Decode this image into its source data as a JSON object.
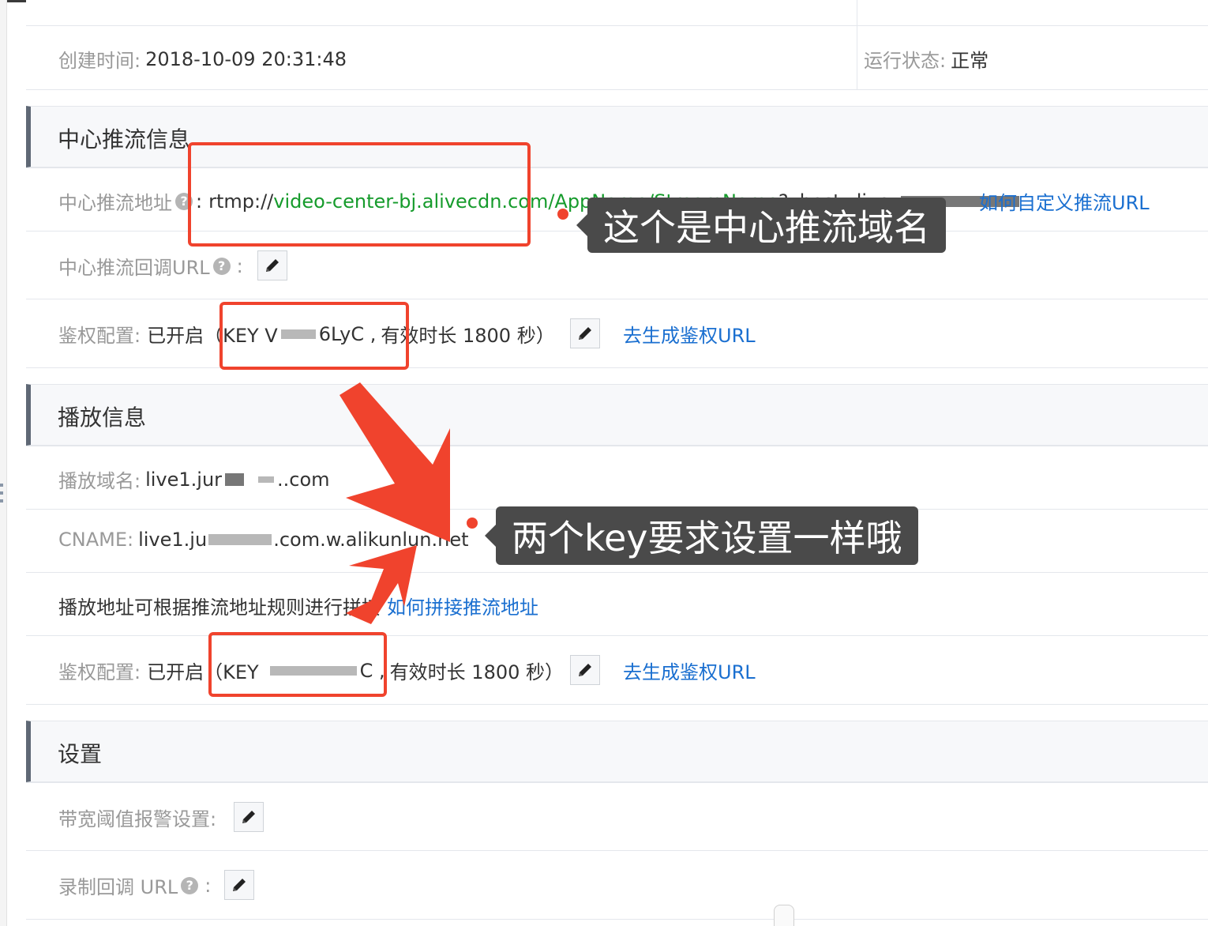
{
  "basic": {
    "created_label": "创建时间:",
    "created_value": "2018-10-09 20:31:48",
    "status_label": "运行状态:",
    "status_value": "正常"
  },
  "center_push": {
    "title": "中心推流信息",
    "address_label": "中心推流地址",
    "address_sep": ":",
    "address_prefix": "rtmp://",
    "address_domain": "video-center-bj.alivecdn.com/",
    "address_app": "AppName",
    "address_slash": "/",
    "address_stream": "StreamName",
    "address_query": "?vhost=live",
    "custom_link": "如何自定义推流URL",
    "callback_label": "中心推流回调URL",
    "callback_sep": ":",
    "auth_label": "鉴权配置:",
    "auth_status": "已开启",
    "auth_key_open": "（KEY V",
    "auth_key_tail": "6LyC ,",
    "auth_validity": "有效时长 1800 秒）",
    "auth_link": "去生成鉴权URL"
  },
  "play": {
    "title": "播放信息",
    "domain_label": "播放域名:",
    "domain_head": "live1.jur",
    "domain_tail": "..com",
    "cname_label": "CNAME:",
    "cname_head": "live1.ju",
    "cname_tail": ".com.w.alikunlun.net",
    "rule_text": "播放地址可根据推流地址规则进行拼接",
    "rule_link": "如何拼接推流地址",
    "auth_label": "鉴权配置:",
    "auth_status": "已开启",
    "auth_key_open": "（KEY",
    "auth_key_tail": "C ,",
    "auth_validity": "有效时长 1800 秒）",
    "auth_link": "去生成鉴权URL"
  },
  "settings": {
    "title": "设置",
    "bandwidth_label": "带宽阈值报警设置:",
    "record_label": "录制回调 URL",
    "record_sep": ":"
  },
  "annotations": {
    "callout_domain": "这个是中心推流域名",
    "callout_keys": "两个key要求设置一样哦",
    "accent": "#f0432d"
  },
  "icons": {
    "help": "question-circle-icon",
    "edit": "pencil-icon",
    "help_glyph": "?"
  }
}
